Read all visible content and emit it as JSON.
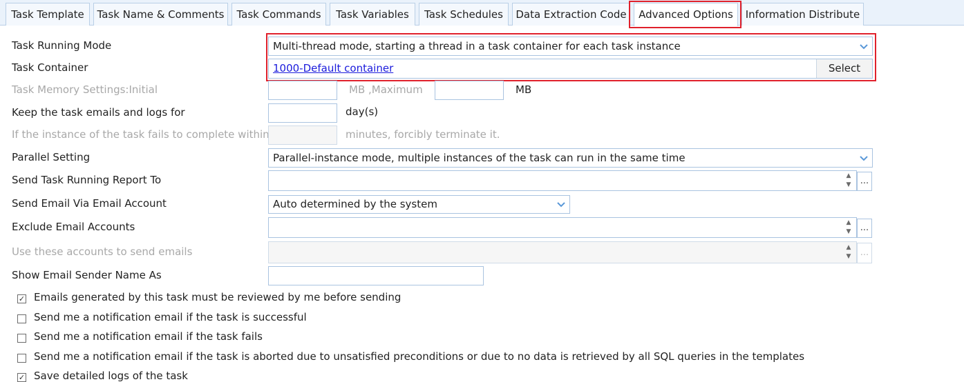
{
  "tabs": [
    {
      "label": "Task Template"
    },
    {
      "label": "Task Name & Comments"
    },
    {
      "label": "Task Commands"
    },
    {
      "label": "Task Variables"
    },
    {
      "label": "Task Schedules"
    },
    {
      "label": "Data Extraction Code"
    },
    {
      "label": "Advanced Options"
    },
    {
      "label": "Information Distribute"
    }
  ],
  "active_tab": "Advanced Options",
  "form": {
    "running_mode": {
      "label": "Task Running Mode",
      "value": "Multi-thread mode, starting a thread in a task container for each task instance"
    },
    "container": {
      "label": "Task Container",
      "value": "1000-Default container",
      "button": "Select"
    },
    "memory": {
      "label": "Task Memory Settings:Initial",
      "mid": "MB ,Maximum",
      "unit": "MB",
      "initial_value": "",
      "maximum_value": ""
    },
    "keep_logs": {
      "label": "Keep the task emails and logs for",
      "unit": "day(s)",
      "value": ""
    },
    "timeout": {
      "label": "If the instance of the task fails to complete within",
      "suffix": "minutes, forcibly terminate it.",
      "value": ""
    },
    "parallel": {
      "label": "Parallel Setting",
      "value": "Parallel-instance mode, multiple instances of the task can run in the same time"
    },
    "report_to": {
      "label": "Send Task Running Report To",
      "value": "",
      "button": "..."
    },
    "email_account": {
      "label": "Send Email Via Email Account",
      "value": "Auto determined by the system"
    },
    "exclude_accounts": {
      "label": "Exclude Email Accounts",
      "value": "",
      "button": "..."
    },
    "use_accounts": {
      "label": "Use these accounts to send emails",
      "value": "",
      "button": "..."
    },
    "sender_name": {
      "label": "Show Email Sender Name As",
      "value": ""
    }
  },
  "checkboxes": [
    {
      "label": "Emails generated by this task must be reviewed by me before sending",
      "checked": true,
      "mark": "✓"
    },
    {
      "label": "Send me a notification email if the task is successful",
      "checked": false,
      "mark": ""
    },
    {
      "label": "Send me a notification email if the task fails",
      "checked": false,
      "mark": ""
    },
    {
      "label": "Send me a notification email if the task is aborted due to unsatisfied preconditions or due to no data is retrieved by all SQL queries in the templates",
      "checked": false,
      "mark": ""
    },
    {
      "label": "Save detailed logs of the task",
      "checked": true,
      "mark": "✓"
    }
  ],
  "colors": {
    "accent": "#5a98d8",
    "highlight": "#e0202b",
    "link": "#1a1adc",
    "tabbar": "#eaf2fb"
  }
}
